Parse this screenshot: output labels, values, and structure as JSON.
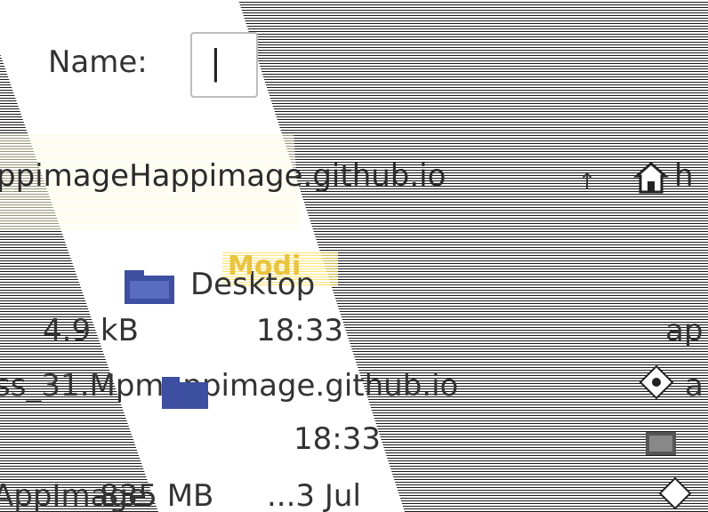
{
  "dialog": {
    "name_label": "Name:",
    "name_value": "|"
  },
  "path_bar": {
    "crumb_text": "ppimageHappimage.github.io",
    "up_glyph": "↑",
    "next_crumb": "h"
  },
  "places": {
    "desktop_label": "Desktop",
    "highlight_text": "Modi"
  },
  "files": [
    {
      "size": "4.9 kB",
      "time": "18:33",
      "type_short": "ap"
    },
    {
      "name": "ss_31.Mpmappimage.github.io",
      "type_short": "a"
    },
    {
      "time": "18:33"
    },
    {
      "name": "AppImage",
      "size": "835 MB",
      "date": "...3 Jul"
    }
  ],
  "icons": {
    "home": "home-icon",
    "folder": "folder-icon",
    "gear": "gear-icon",
    "file": "file-icon"
  },
  "colors": {
    "folder_blue": "#3c4fa0",
    "highlight_yellow": "#ffd24a",
    "stripe_dark": "#1a1a1a"
  }
}
